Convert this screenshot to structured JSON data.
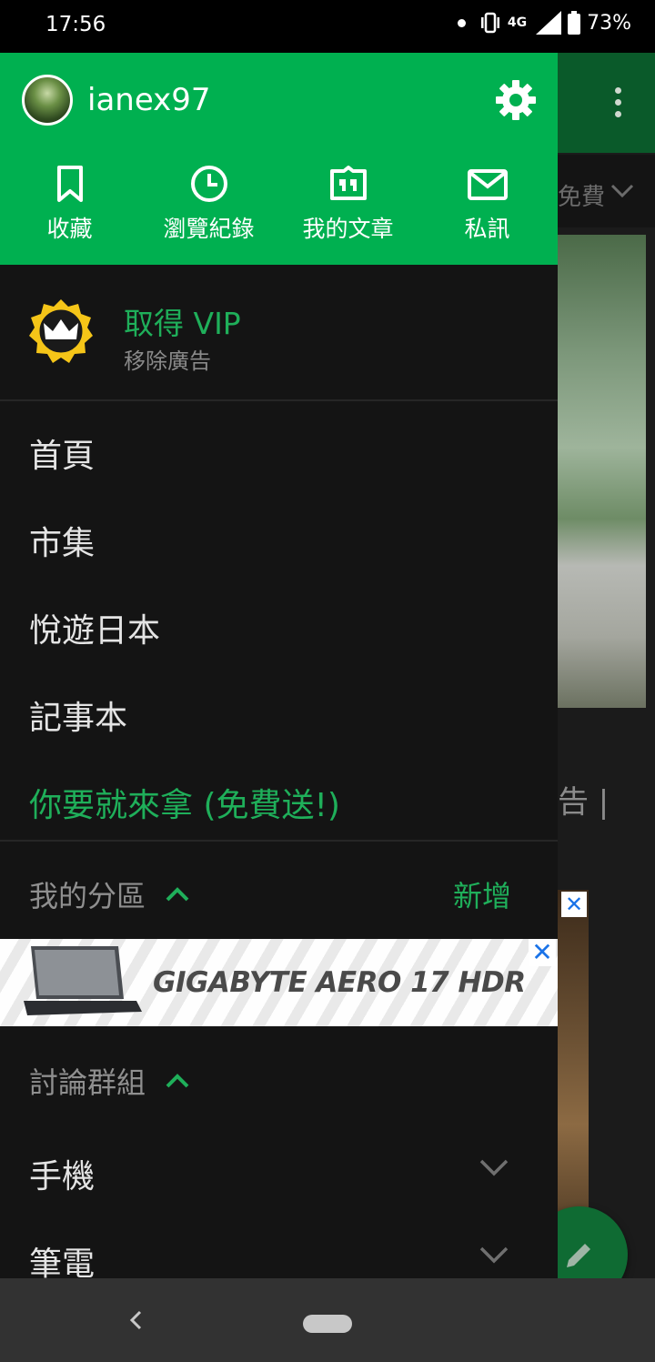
{
  "status_bar": {
    "time": "17:56",
    "network": "4G",
    "battery": "73%"
  },
  "background": {
    "filter_text": "免費",
    "caption_text": "告 |"
  },
  "drawer": {
    "username": "ianex97",
    "quick_actions": [
      {
        "label": "收藏",
        "icon": "bookmark-icon"
      },
      {
        "label": "瀏覽紀錄",
        "icon": "clock-icon"
      },
      {
        "label": "我的文章",
        "icon": "quote-icon"
      },
      {
        "label": "私訊",
        "icon": "mail-icon"
      }
    ],
    "vip": {
      "title": "取得 VIP",
      "subtitle": "移除廣告"
    },
    "menu": [
      {
        "label": "首頁"
      },
      {
        "label": "市集"
      },
      {
        "label": "悅遊日本"
      },
      {
        "label": "記事本"
      },
      {
        "label": "你要就來拿 (免費送!)"
      }
    ],
    "my_sections": {
      "title": "我的分區",
      "add_label": "新增"
    },
    "ad": {
      "text": "GIGABYTE AERO 17 HDR",
      "close": "✕"
    },
    "groups": {
      "title": "討論群組",
      "items": [
        {
          "label": "手機"
        },
        {
          "label": "筆電"
        }
      ]
    }
  },
  "colors": {
    "header_green": "#00b050",
    "accent_green": "#1faf5a",
    "drawer_bg": "#141414"
  }
}
